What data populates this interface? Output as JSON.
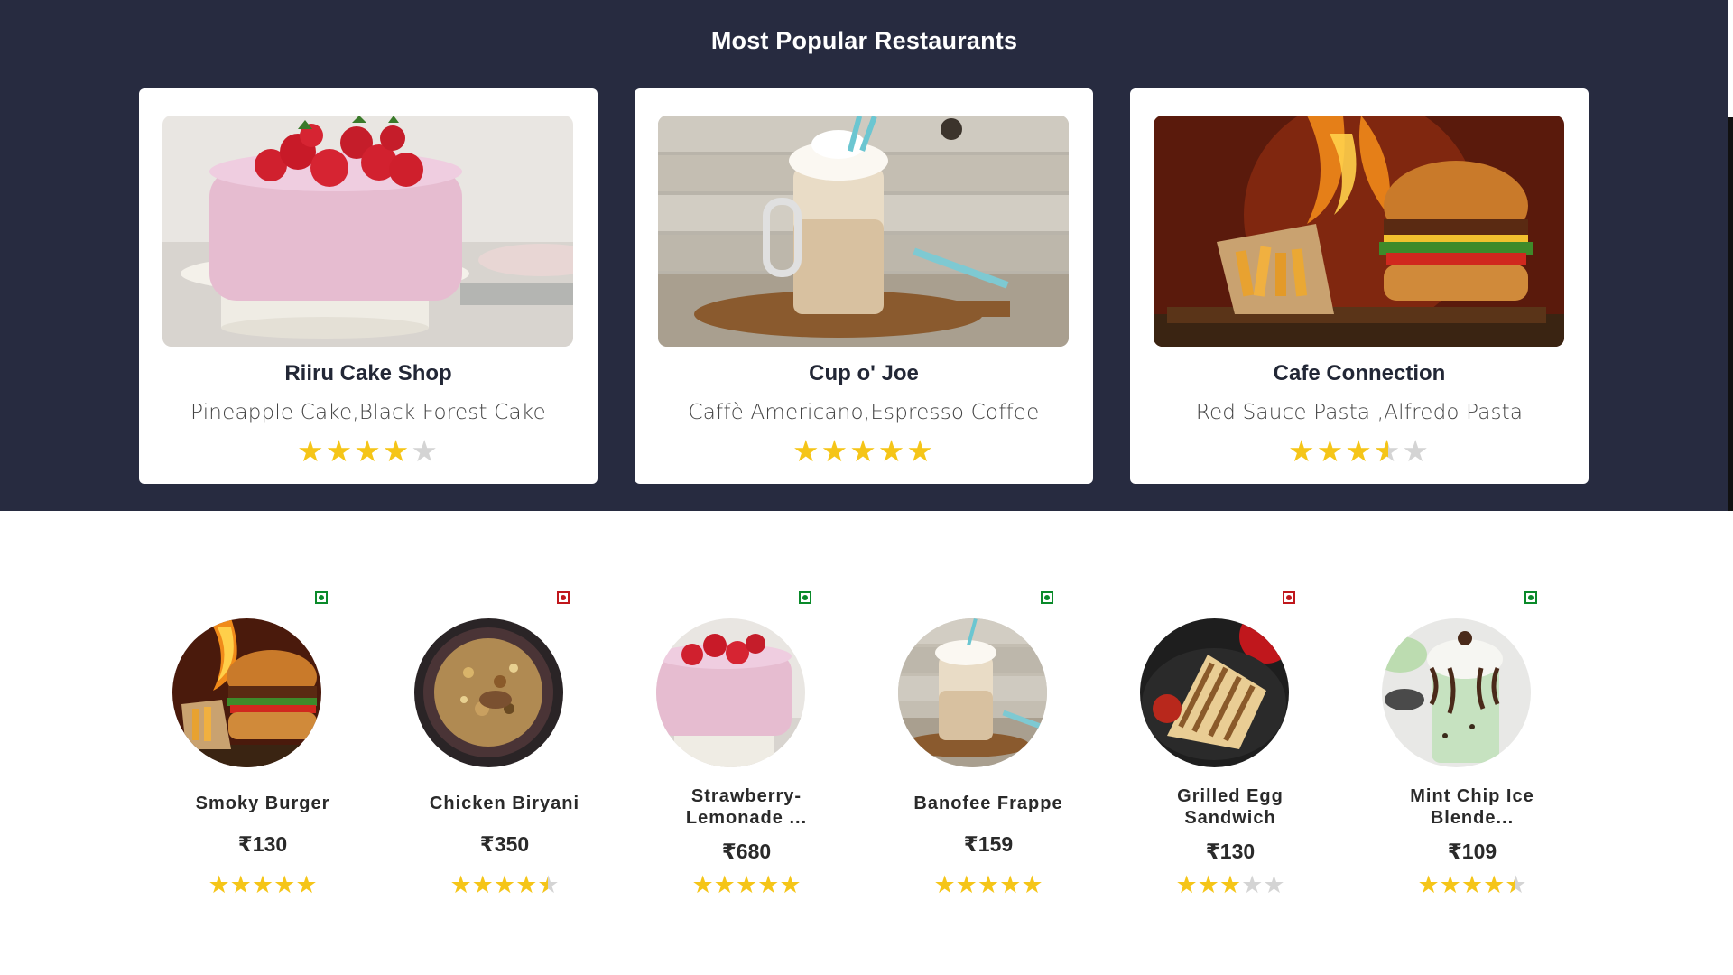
{
  "popular": {
    "title": "Most Popular Restaurants",
    "restaurants": [
      {
        "name": "Riiru Cake Shop",
        "items": "Pineapple Cake,Black Forest Cake",
        "rating": 4,
        "image": "strawberry-cake"
      },
      {
        "name": "Cup o' Joe",
        "items": "Caffè Americano,Espresso Coffee",
        "rating": 5,
        "image": "iced-coffee"
      },
      {
        "name": "Cafe Connection",
        "items": "Red Sauce Pasta ,Alfredo Pasta",
        "rating": 3.5,
        "image": "burger-fries"
      }
    ]
  },
  "dishes": [
    {
      "name": "Smoky Burger",
      "price": "₹130",
      "rating": 5,
      "type": "veg",
      "image": "burger"
    },
    {
      "name": "Chicken Biryani",
      "price": "₹350",
      "rating": 4.5,
      "type": "non-veg",
      "image": "biryani"
    },
    {
      "name": "Strawberry-Lemonade ...",
      "name_line1": "Strawberry-",
      "name_line2": "Lemonade ...",
      "price": "₹680",
      "rating": 5,
      "type": "veg",
      "image": "strawberry-cake"
    },
    {
      "name": "Banofee Frappe",
      "price": "₹159",
      "rating": 5,
      "type": "veg",
      "image": "iced-coffee"
    },
    {
      "name": "Grilled Egg Sandwich",
      "name_line1": "Grilled Egg",
      "name_line2": "Sandwich",
      "price": "₹130",
      "rating": 3,
      "type": "non-veg",
      "image": "sandwich"
    },
    {
      "name": "Mint Chip Ice Blende...",
      "name_line1": "Mint Chip Ice",
      "name_line2": "Blende...",
      "price": "₹109",
      "rating": 4.5,
      "type": "veg",
      "image": "mint-shake"
    }
  ],
  "colors": {
    "band": "#272b40",
    "star": "#f5c518",
    "star_empty": "#d4d4d4",
    "veg": "#0a8a2a",
    "nonveg": "#c0171c"
  }
}
